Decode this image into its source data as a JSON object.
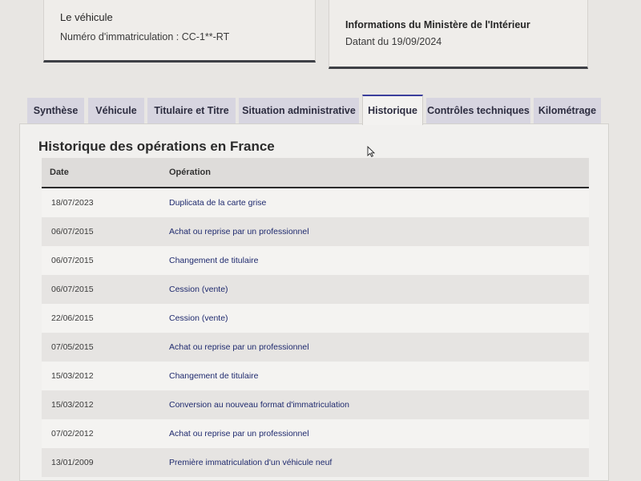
{
  "vehicle_card": {
    "title": "Le véhicule",
    "plate_label": "Numéro d'immatriculation : CC-1**-RT"
  },
  "info_card": {
    "title": "Informations du Ministère de l'Intérieur",
    "date_label": "Datant du 19/09/2024"
  },
  "tabs": [
    {
      "label": "Synthèse",
      "active": false
    },
    {
      "label": "Véhicule",
      "active": false
    },
    {
      "label": "Titulaire et Titre",
      "active": false
    },
    {
      "label": "Situation administrative",
      "active": false
    },
    {
      "label": "Historique",
      "active": true
    },
    {
      "label": "Contrôles techniques",
      "active": false
    },
    {
      "label": "Kilométrage",
      "active": false
    }
  ],
  "history": {
    "title": "Historique des opérations en France",
    "columns": {
      "date": "Date",
      "operation": "Opération"
    },
    "rows": [
      {
        "date": "18/07/2023",
        "operation": "Duplicata de la carte grise"
      },
      {
        "date": "06/07/2015",
        "operation": "Achat ou reprise par un professionnel"
      },
      {
        "date": "06/07/2015",
        "operation": "Changement de titulaire"
      },
      {
        "date": "06/07/2015",
        "operation": "Cession (vente)"
      },
      {
        "date": "22/06/2015",
        "operation": "Cession (vente)"
      },
      {
        "date": "07/05/2015",
        "operation": "Achat ou reprise par un professionnel"
      },
      {
        "date": "15/03/2012",
        "operation": "Changement de titulaire"
      },
      {
        "date": "15/03/2012",
        "operation": "Conversion au nouveau format d'immatriculation"
      },
      {
        "date": "07/02/2012",
        "operation": "Achat ou reprise par un professionnel"
      },
      {
        "date": "13/01/2009",
        "operation": "Première immatriculation d'un véhicule neuf"
      }
    ]
  },
  "colors": {
    "accent": "#3b3f9c",
    "tab_inactive": "#d7d5e0",
    "link_text": "#1f2a6e"
  },
  "icons": {
    "cursor": "arrow-cursor-icon"
  }
}
